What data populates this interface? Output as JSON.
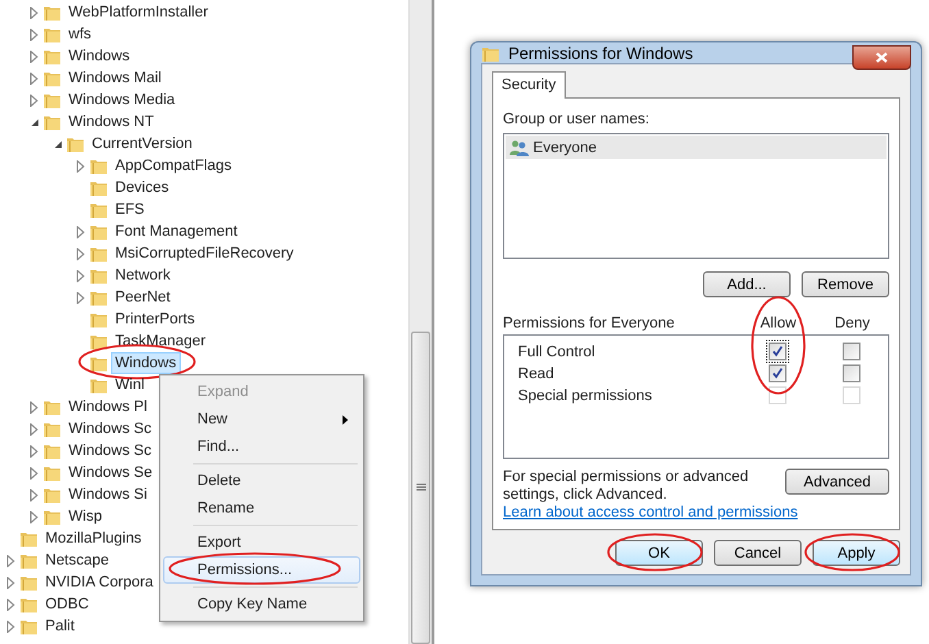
{
  "tree": {
    "continued_children": [
      {
        "label": "WebPlatformInstaller",
        "has_children": true,
        "expanded": false,
        "selected": false
      },
      {
        "label": "wfs",
        "has_children": true,
        "expanded": false,
        "selected": false
      },
      {
        "label": "Windows",
        "has_children": true,
        "expanded": false,
        "selected": false
      },
      {
        "label": "Windows Mail",
        "has_children": true,
        "expanded": false,
        "selected": false
      },
      {
        "label": "Windows Media",
        "has_children": true,
        "expanded": false,
        "selected": false
      },
      {
        "label": "Windows NT",
        "has_children": true,
        "expanded": true,
        "selected": false,
        "children": [
          {
            "label": "CurrentVersion",
            "has_children": true,
            "expanded": true,
            "selected": false,
            "children": [
              {
                "label": "AppCompatFlags",
                "has_children": true,
                "expanded": false,
                "selected": false
              },
              {
                "label": "Devices",
                "has_children": false,
                "selected": false
              },
              {
                "label": "EFS",
                "has_children": false,
                "selected": false
              },
              {
                "label": "Font Management",
                "has_children": true,
                "expanded": false,
                "selected": false
              },
              {
                "label": "MsiCorruptedFileRecovery",
                "has_children": true,
                "expanded": false,
                "selected": false
              },
              {
                "label": "Network",
                "has_children": true,
                "expanded": false,
                "selected": false
              },
              {
                "label": "PeerNet",
                "has_children": true,
                "expanded": false,
                "selected": false
              },
              {
                "label": "PrinterPorts",
                "has_children": false,
                "selected": false
              },
              {
                "label": "TaskManager",
                "has_children": false,
                "selected": false
              },
              {
                "label": "Windows",
                "has_children": false,
                "selected": true,
                "circled": true
              },
              {
                "label": "Winl",
                "has_children": false,
                "selected": false
              }
            ]
          }
        ]
      },
      {
        "label": "Windows Pl",
        "has_children": true,
        "expanded": false,
        "selected": false
      },
      {
        "label": "Windows Sc",
        "has_children": true,
        "expanded": false,
        "selected": false
      },
      {
        "label": "Windows Sc",
        "has_children": true,
        "expanded": false,
        "selected": false
      },
      {
        "label": "Windows Se",
        "has_children": true,
        "expanded": false,
        "selected": false
      },
      {
        "label": "Windows Si",
        "has_children": true,
        "expanded": false,
        "selected": false
      },
      {
        "label": "Wisp",
        "has_children": true,
        "expanded": false,
        "selected": false
      }
    ],
    "items": [
      {
        "label": "MozillaPlugins",
        "has_children": false,
        "selected": false
      },
      {
        "label": "Netscape",
        "has_children": true,
        "expanded": false,
        "selected": false
      },
      {
        "label": "NVIDIA Corpora",
        "has_children": true,
        "expanded": false,
        "selected": false
      },
      {
        "label": "ODBC",
        "has_children": true,
        "expanded": false,
        "selected": false
      },
      {
        "label": "Palit",
        "has_children": true,
        "expanded": false,
        "selected": false
      }
    ]
  },
  "context_menu": {
    "items": [
      {
        "kind": "item",
        "label": "Expand",
        "disabled": true,
        "highlighted": false,
        "submenu": false
      },
      {
        "kind": "item",
        "label": "New",
        "disabled": false,
        "highlighted": false,
        "submenu": true
      },
      {
        "kind": "item",
        "label": "Find...",
        "disabled": false,
        "highlighted": false,
        "submenu": false
      },
      {
        "kind": "separator"
      },
      {
        "kind": "item",
        "label": "Delete",
        "disabled": false,
        "highlighted": false,
        "submenu": false
      },
      {
        "kind": "item",
        "label": "Rename",
        "disabled": false,
        "highlighted": false,
        "submenu": false
      },
      {
        "kind": "separator"
      },
      {
        "kind": "item",
        "label": "Export",
        "disabled": false,
        "highlighted": false,
        "submenu": false
      },
      {
        "kind": "item",
        "label": "Permissions...",
        "disabled": false,
        "highlighted": true,
        "submenu": false,
        "circled": true
      },
      {
        "kind": "separator"
      },
      {
        "kind": "item",
        "label": "Copy Key Name",
        "disabled": false,
        "highlighted": false,
        "submenu": false
      }
    ]
  },
  "dialog": {
    "title": "Permissions for Windows",
    "tabs": [
      {
        "label": "Security",
        "selected": true
      }
    ],
    "group_label": "Group or user names:",
    "users": [
      {
        "name": "Everyone",
        "selected": true
      }
    ],
    "user_buttons": [
      "Add...",
      "Remove"
    ],
    "permissions_label": "Permissions for Everyone",
    "columns": [
      {
        "label": "Allow",
        "circled": true
      },
      {
        "label": "Deny",
        "circled": false
      }
    ],
    "permissions": [
      {
        "name": "Full Control",
        "allow": true,
        "deny": false,
        "disabled": false,
        "focused": true
      },
      {
        "name": "Read",
        "allow": true,
        "deny": false,
        "disabled": false,
        "focused": false
      },
      {
        "name": "Special permissions",
        "allow": false,
        "deny": false,
        "disabled": true,
        "focused": false
      }
    ],
    "advanced_text": "For special permissions or advanced settings, click Advanced.",
    "advanced_button": "Advanced",
    "link": "Learn about access control and permissions",
    "buttons": [
      {
        "label": "OK",
        "circled": true
      },
      {
        "label": "Cancel",
        "circled": false
      },
      {
        "label": "Apply",
        "circled": true
      }
    ]
  }
}
